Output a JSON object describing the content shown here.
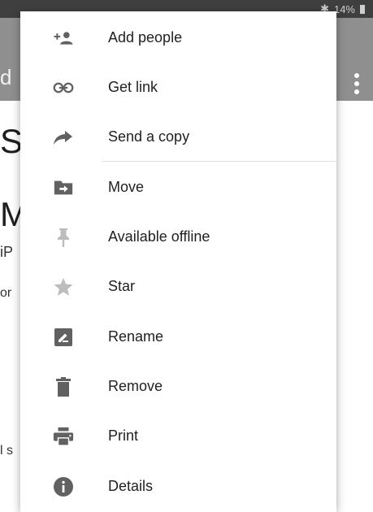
{
  "status_bar": {
    "battery": "14%"
  },
  "app_bar": {
    "title_fragment": "d"
  },
  "background_fragments": [
    "S",
    "M",
    "iP",
    "or",
    "l s"
  ],
  "menu": {
    "items": [
      {
        "label": "Add people",
        "icon": "person-add-icon"
      },
      {
        "label": "Get link",
        "icon": "link-icon"
      },
      {
        "label": "Send a copy",
        "icon": "share-arrow-icon"
      },
      {
        "label": "Move",
        "icon": "folder-move-icon"
      },
      {
        "label": "Available offline",
        "icon": "pin-icon"
      },
      {
        "label": "Star",
        "icon": "star-icon"
      },
      {
        "label": "Rename",
        "icon": "rename-icon"
      },
      {
        "label": "Remove",
        "icon": "trash-icon"
      },
      {
        "label": "Print",
        "icon": "printer-icon"
      },
      {
        "label": "Details",
        "icon": "info-icon"
      }
    ]
  },
  "colors": {
    "icon": "#616161",
    "icon_disabled": "#bdbdbd",
    "text": "#212121",
    "app_bar": "#8f8f8f"
  }
}
